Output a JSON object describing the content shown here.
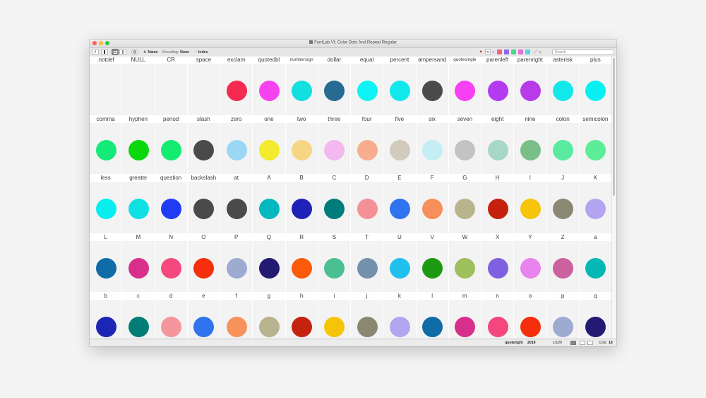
{
  "window": {
    "title": "FontLab VI: Color Dots And Repeat Regular"
  },
  "toolbar": {
    "info_label": "i",
    "sort_name_label": "Name",
    "encoding_prefix": "Encoding:",
    "encoding_value": "None",
    "index_label": "Index",
    "search_placeholder": "Search",
    "swatch_colors": [
      "#f06479",
      "#8f67e8",
      "#49d888",
      "#e36fd8",
      "#52d8e4"
    ]
  },
  "glyphs": [
    {
      "name": ".notdef",
      "color": null
    },
    {
      "name": "NULL",
      "color": null
    },
    {
      "name": "CR",
      "color": null
    },
    {
      "name": "space",
      "color": null
    },
    {
      "name": "exclam",
      "color": "#f42a50"
    },
    {
      "name": "quotedbl",
      "color": "#f742f0"
    },
    {
      "name": "numbersign",
      "color": "#11dfe0",
      "small": true
    },
    {
      "name": "dollar",
      "color": "#266b92"
    },
    {
      "name": "equal",
      "color": "#0ef3f3"
    },
    {
      "name": "percent",
      "color": "#10e8ec"
    },
    {
      "name": "ampersand",
      "color": "#4b4b4b"
    },
    {
      "name": "quotesingle",
      "color": "#f840f4",
      "small": true
    },
    {
      "name": "parenleft",
      "color": "#b43aef"
    },
    {
      "name": "parenright",
      "color": "#b83ae9"
    },
    {
      "name": "asterisk",
      "color": "#12e8ec"
    },
    {
      "name": "plus",
      "color": "#08f0f2"
    },
    {
      "name": "comma",
      "color": "#14ea78"
    },
    {
      "name": "hyphen",
      "color": "#0ad80c"
    },
    {
      "name": "period",
      "color": "#13ec70"
    },
    {
      "name": "slash",
      "color": "#4a4a4a"
    },
    {
      "name": "zero",
      "color": "#9ad7f4"
    },
    {
      "name": "one",
      "color": "#f4ea2e"
    },
    {
      "name": "two",
      "color": "#f6d683"
    },
    {
      "name": "three",
      "color": "#f3b8f0"
    },
    {
      "name": "four",
      "color": "#f8ad8e"
    },
    {
      "name": "five",
      "color": "#d2cabd"
    },
    {
      "name": "six",
      "color": "#c4edf5"
    },
    {
      "name": "seven",
      "color": "#c2c2c2"
    },
    {
      "name": "eight",
      "color": "#a6d8c5"
    },
    {
      "name": "nine",
      "color": "#7abe88"
    },
    {
      "name": "colon",
      "color": "#5aeaa0"
    },
    {
      "name": "semicolon",
      "color": "#5ced98"
    },
    {
      "name": "less",
      "color": "#06eeee"
    },
    {
      "name": "greater",
      "color": "#0fe0e3"
    },
    {
      "name": "question",
      "color": "#1f3cf4"
    },
    {
      "name": "backslash",
      "color": "#4a4a4a"
    },
    {
      "name": "at",
      "color": "#4b4b4b"
    },
    {
      "name": "A",
      "color": "#04b8bf"
    },
    {
      "name": "B",
      "color": "#1e22b8"
    },
    {
      "name": "C",
      "color": "#007c7a"
    },
    {
      "name": "D",
      "color": "#f59196"
    },
    {
      "name": "E",
      "color": "#2f74ef"
    },
    {
      "name": "F",
      "color": "#f78f5b"
    },
    {
      "name": "G",
      "color": "#b9b48e"
    },
    {
      "name": "H",
      "color": "#c5210e"
    },
    {
      "name": "I",
      "color": "#f6c408"
    },
    {
      "name": "J",
      "color": "#8a8872"
    },
    {
      "name": "K",
      "color": "#b3a4f0"
    },
    {
      "name": "L",
      "color": "#0f6ca6"
    },
    {
      "name": "M",
      "color": "#d92f8c"
    },
    {
      "name": "N",
      "color": "#f4487e"
    },
    {
      "name": "O",
      "color": "#f52f0c"
    },
    {
      "name": "P",
      "color": "#9cabcf"
    },
    {
      "name": "Q",
      "color": "#231a74"
    },
    {
      "name": "R",
      "color": "#fa5a0a"
    },
    {
      "name": "S",
      "color": "#4abf92"
    },
    {
      "name": "T",
      "color": "#7390ad"
    },
    {
      "name": "U",
      "color": "#1fc0ee"
    },
    {
      "name": "V",
      "color": "#1e9a12"
    },
    {
      "name": "W",
      "color": "#9dbf5c"
    },
    {
      "name": "X",
      "color": "#7e60e0"
    },
    {
      "name": "Y",
      "color": "#e984ef"
    },
    {
      "name": "Z",
      "color": "#cb619f"
    },
    {
      "name": "a",
      "color": "#06b8b5"
    },
    {
      "name": "b",
      "color": "#1c25b6"
    },
    {
      "name": "c",
      "color": "#017c77"
    },
    {
      "name": "d",
      "color": "#f4969b"
    },
    {
      "name": "e",
      "color": "#2f74ee"
    },
    {
      "name": "f",
      "color": "#f7925b"
    },
    {
      "name": "g",
      "color": "#b8b38e"
    },
    {
      "name": "h",
      "color": "#c5230f"
    },
    {
      "name": "i",
      "color": "#f6c407"
    },
    {
      "name": "j",
      "color": "#8a8772"
    },
    {
      "name": "k",
      "color": "#b3a5f0"
    },
    {
      "name": "l",
      "color": "#0f6ca6"
    },
    {
      "name": "m",
      "color": "#d82f8c"
    },
    {
      "name": "n",
      "color": "#f4477e"
    },
    {
      "name": "o",
      "color": "#f52e0b"
    },
    {
      "name": "p",
      "color": "#9cabcf"
    },
    {
      "name": "q",
      "color": "#231a74"
    }
  ],
  "status": {
    "glyph_name": "quoteright",
    "unicode": "2019",
    "position": "1/120",
    "cols_label": "Cols:",
    "cols_value": "16"
  }
}
